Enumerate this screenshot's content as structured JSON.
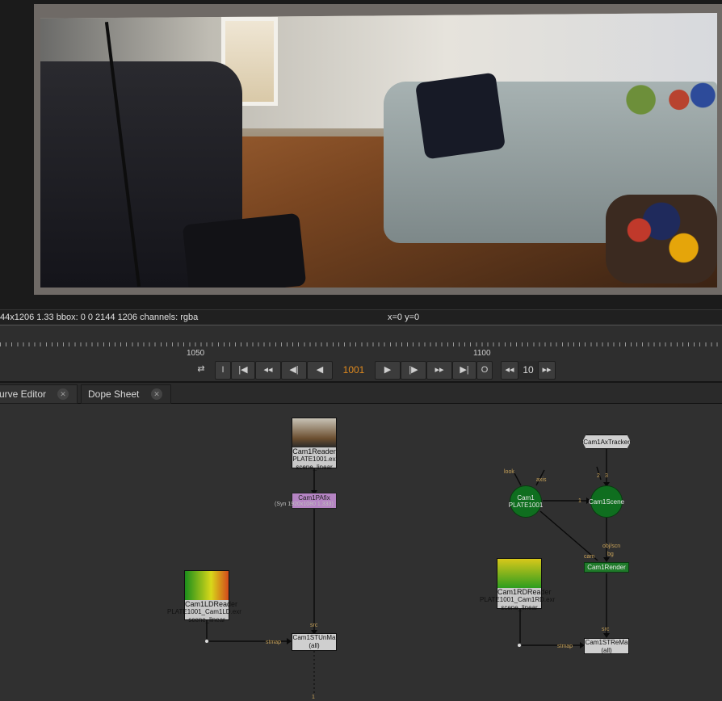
{
  "viewer": {
    "status_format": "44x1206 1.33  bbox: 0 0 2144 1206 channels: rgba",
    "coords": "x=0 y=0"
  },
  "timeline": {
    "tick_1050": "1050",
    "tick_1100": "1100",
    "current_frame": "1001",
    "step": "10",
    "btn_in": "I",
    "btn_out": "O"
  },
  "tabs": [
    {
      "label": "urve Editor"
    },
    {
      "label": "Dope Sheet"
    }
  ],
  "nodes": {
    "cam1reader": {
      "title": "Cam1Reader",
      "file": "PLATE1001.ex",
      "cs": "scene_linear"
    },
    "cam1pafix": {
      "title": "Cam1PAfix",
      "sub": "(Syn 1920x1080 1.333)"
    },
    "cam1ldreader": {
      "title": "Cam1LDReader",
      "file": "PLATE1001_Cam1LD.exr",
      "cs": "scene_linear"
    },
    "cam1stunmap": {
      "title": "Cam1STUnMa",
      "sub": "(all)"
    },
    "cam1axtracker": {
      "title": "Cam1AxTracker"
    },
    "cam1": {
      "title": "Cam1",
      "sub": "PLATE1001"
    },
    "cam1scene": {
      "title": "Cam1Scene"
    },
    "cam1render": {
      "title": "Cam1Render"
    },
    "cam1rdreader": {
      "title": "Cam1RDReader",
      "file": "PLATE1001_Cam1RD.exr",
      "cs": "scene_linear"
    },
    "cam1stremap": {
      "title": "Cam1STReMa",
      "sub": "(all)"
    }
  },
  "pipe_labels": {
    "src1": "src",
    "stmap1": "stmap",
    "look": "look",
    "axis": "axis",
    "in2": "2",
    "in3": "3",
    "one": "1",
    "obj_scn": "obj/scn",
    "bg": "bg",
    "cam": "cam",
    "src2": "src",
    "stmap2": "stmap",
    "one_bottom": "1"
  },
  "colors": {
    "frame_accent": "#e08a1e",
    "scene_node": "#0f6e1f",
    "pafix_node": "#b584c3"
  }
}
